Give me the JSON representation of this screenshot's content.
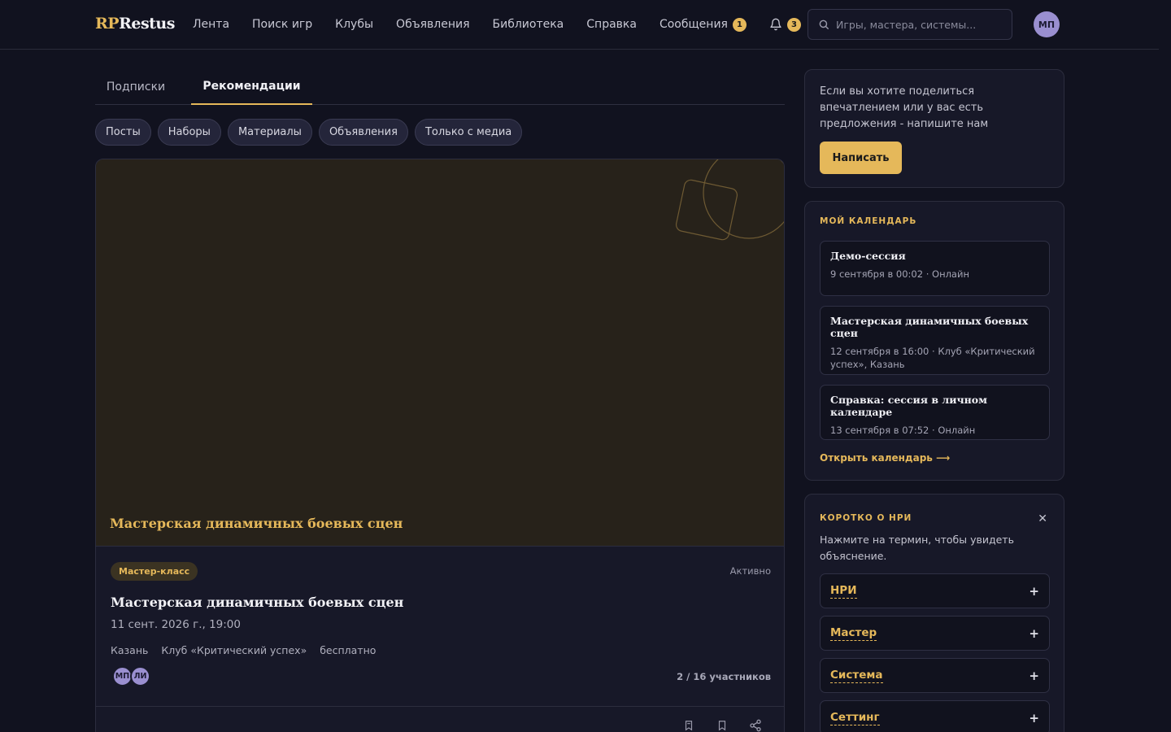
{
  "header": {
    "logo_rp": "RP",
    "logo_rest": "Restus",
    "nav": [
      "Лента",
      "Поиск игр",
      "Клубы",
      "Объявления",
      "Библиотека",
      "Справка",
      "Сообщения"
    ],
    "messages_badge": "1",
    "notifications_badge": "3",
    "search_placeholder": "Игры, мастера, системы...",
    "avatar_initials": "МП"
  },
  "tabs": [
    "Подписки",
    "Рекомендации"
  ],
  "filters": [
    "Посты",
    "Наборы",
    "Материалы",
    "Объявления",
    "Только с медиа"
  ],
  "card": {
    "cover_title": "Мастерская динамичных боевых сцен",
    "tag": "Мастер-класс",
    "status": "Активно",
    "title": "Мастерская динамичных боевых сцен",
    "date": "11 сент. 2026 г., 19:00",
    "meta": [
      "Казань",
      "Клуб «Критический успех»",
      "бесплатно"
    ],
    "avatars": [
      "МП",
      "ЛИ"
    ],
    "participants": "2 / 16 участников"
  },
  "feedback": {
    "text": "Если вы хотите поделиться впечатлением или у вас есть предложения - напишите нам",
    "button": "Написать"
  },
  "calendar": {
    "title": "МОЙ КАЛЕНДАРЬ",
    "events": [
      {
        "title": "Демо-сессия",
        "sub": "9 сентября в 00:02 · Онлайн"
      },
      {
        "title": "Мастерская динамичных боевых сцен",
        "sub": "12 сентября в 16:00 · Клуб «Критический успех», Казань"
      },
      {
        "title": "Справка: сессия в личном календаре",
        "sub": "13 сентября в 07:52 · Онлайн"
      }
    ],
    "link": "Открыть календарь ⟶"
  },
  "glossary": {
    "title": "КОРОТКО О НРИ",
    "text": "Нажмите на термин, чтобы увидеть объяснение.",
    "terms": [
      "НРИ",
      "Мастер",
      "Система",
      "Сеттинг"
    ]
  },
  "colors": {
    "accent": "#e5b85a",
    "background": "#11121f",
    "card": "#171828",
    "cover": "#27221a"
  }
}
